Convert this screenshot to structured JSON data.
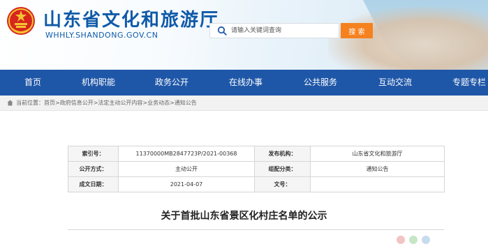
{
  "header": {
    "site_name": "山东省文化和旅游厅",
    "site_domain": "WHHLY.SHANDONG.GOV.CN",
    "emblem_icon": "national-emblem-icon",
    "search": {
      "placeholder": "请输入关键词查询",
      "value": "",
      "button_label": "搜 索"
    }
  },
  "nav": {
    "items": [
      "首页",
      "机构职能",
      "政务公开",
      "在线办事",
      "公共服务",
      "互动交流",
      "专题专栏"
    ]
  },
  "breadcrumb": {
    "icon": "home-icon",
    "text": "当前位置：首页>政府信息公开>法定主动公开内容>业务动态>通知公告"
  },
  "meta": {
    "index_label": "索引号：",
    "index_value": "11370000MB2847723P/2021-00368",
    "issuer_label": "发布机构：",
    "issuer_value": "山东省文化和旅游厅",
    "disclosure_label": "公开方式：",
    "disclosure_value": "主动公开",
    "category_label": "组配分类：",
    "category_value": "通知公告",
    "date_label": "成文日期：",
    "date_value": "2021-04-07",
    "docno_label": "文号：",
    "docno_value": ""
  },
  "article": {
    "title": "关于首批山东省景区化村庄名单的公示"
  },
  "colors": {
    "brand_blue": "#1f57a8",
    "title_blue": "#0f5aa8",
    "search_orange": "#f5811f"
  }
}
